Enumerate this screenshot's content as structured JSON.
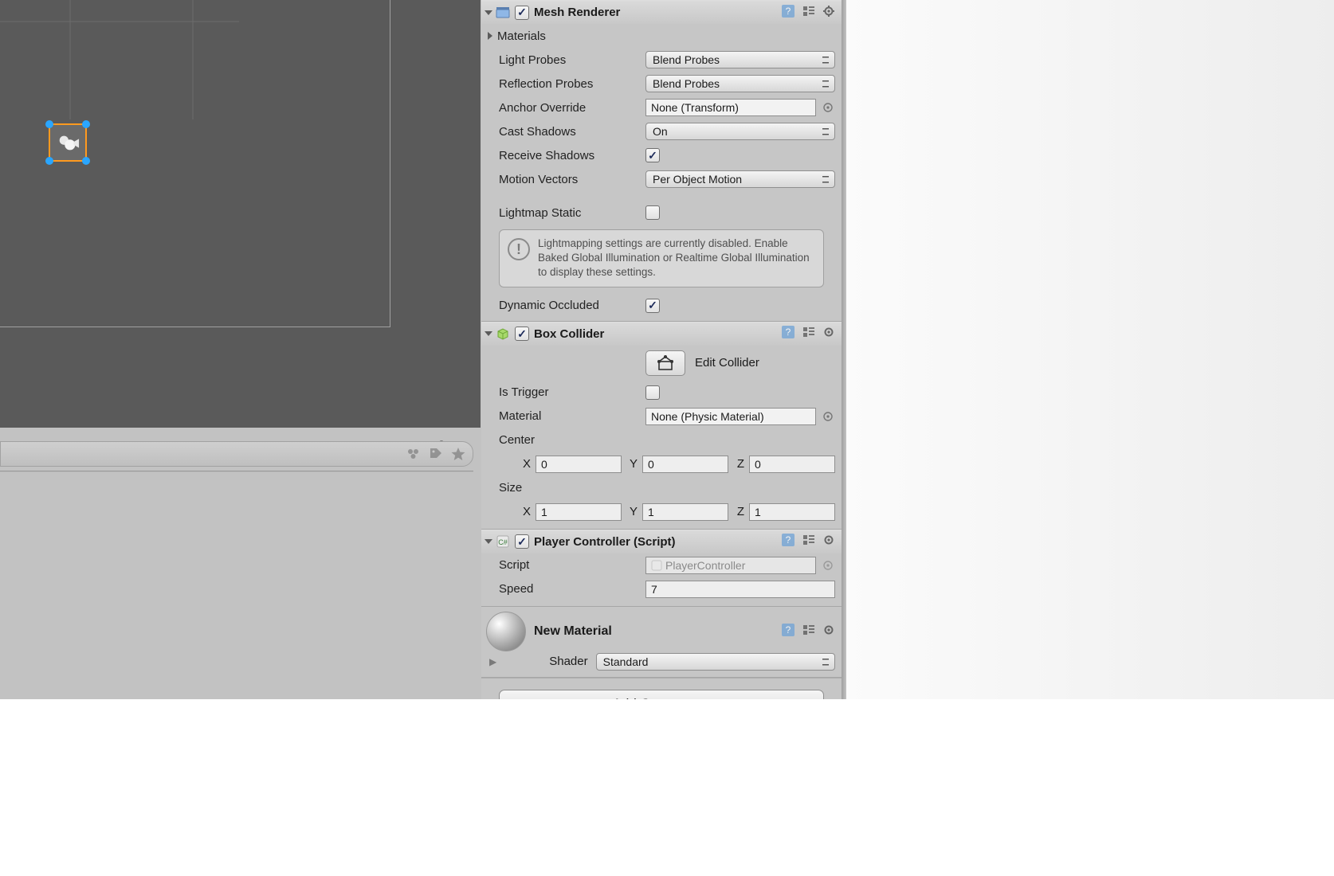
{
  "scene": {
    "has_selection": true
  },
  "inspector": {
    "mesh_renderer": {
      "title": "Mesh Renderer",
      "enabled": true,
      "materials_label": "Materials",
      "light_probes": {
        "label": "Light Probes",
        "value": "Blend Probes"
      },
      "reflection_probes": {
        "label": "Reflection Probes",
        "value": "Blend Probes"
      },
      "anchor_override": {
        "label": "Anchor Override",
        "value": "None (Transform)"
      },
      "cast_shadows": {
        "label": "Cast Shadows",
        "value": "On"
      },
      "receive_shadows": {
        "label": "Receive Shadows",
        "value": true
      },
      "motion_vectors": {
        "label": "Motion Vectors",
        "value": "Per Object Motion"
      },
      "lightmap_static": {
        "label": "Lightmap Static",
        "value": false
      },
      "lightmap_info": "Lightmapping settings are currently disabled. Enable Baked Global Illumination or Realtime Global Illumination to display these settings.",
      "dynamic_occluded": {
        "label": "Dynamic Occluded",
        "value": true
      }
    },
    "box_collider": {
      "title": "Box Collider",
      "enabled": true,
      "edit_collider_label": "Edit Collider",
      "is_trigger": {
        "label": "Is Trigger",
        "value": false
      },
      "material": {
        "label": "Material",
        "value": "None (Physic Material)"
      },
      "center": {
        "label": "Center",
        "x": "0",
        "y": "0",
        "z": "0"
      },
      "size": {
        "label": "Size",
        "x": "1",
        "y": "1",
        "z": "1"
      }
    },
    "player_controller": {
      "title": "Player Controller (Script)",
      "enabled": true,
      "script": {
        "label": "Script",
        "value": "PlayerController"
      },
      "speed": {
        "label": "Speed",
        "value": "7"
      }
    },
    "material": {
      "title": "New Material",
      "shader_label": "Shader",
      "shader_value": "Standard"
    },
    "add_component_label": "Add Component"
  }
}
